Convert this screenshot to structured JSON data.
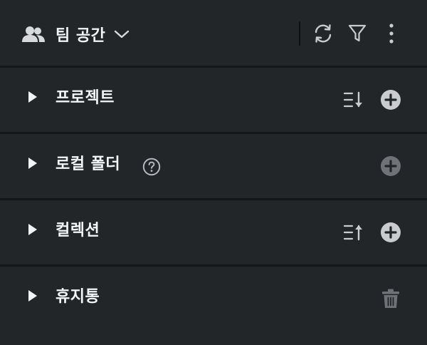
{
  "header": {
    "team_icon": "users-icon",
    "title": "팀 공간",
    "dropdown_icon": "chevron-down-icon",
    "actions": [
      "refresh-icon",
      "filter-icon",
      "more-vertical-icon"
    ]
  },
  "sections": [
    {
      "label": "프로젝트",
      "actions": [
        "sort-descending-icon",
        "add-circle-icon"
      ]
    },
    {
      "label": "로컬 폴더",
      "help_icon": "help-circle-icon",
      "actions": [
        "add-circle-icon"
      ],
      "add_state": "disabled"
    },
    {
      "label": "컬렉션",
      "actions": [
        "sort-ascending-icon",
        "add-circle-icon"
      ]
    },
    {
      "label": "휴지통",
      "actions": [
        "trash-icon"
      ]
    }
  ],
  "colors": {
    "background": "#222427",
    "row": "#232629",
    "divider": "#151618",
    "text": "#f2f3f5",
    "icon": "#c9cbcf",
    "icon_muted": "#6f7277"
  }
}
